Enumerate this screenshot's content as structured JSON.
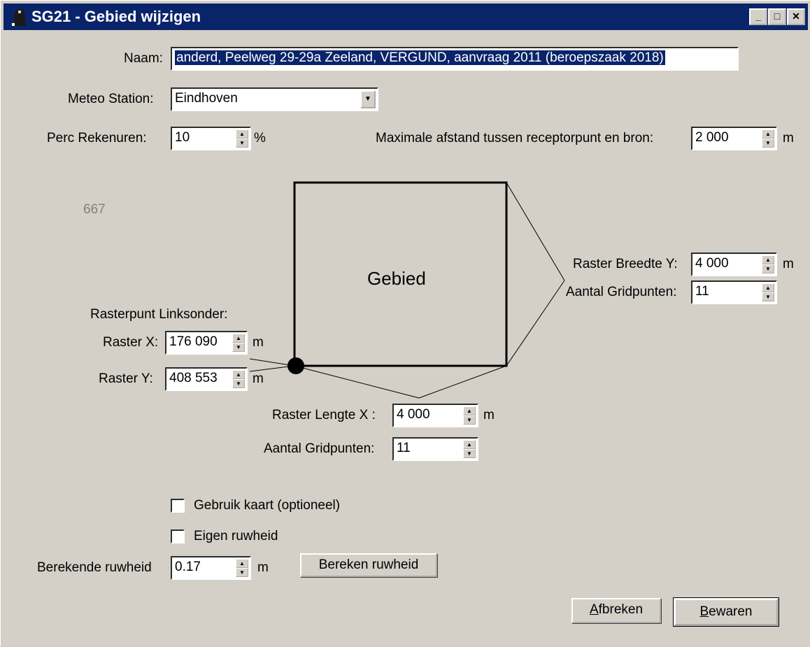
{
  "window": {
    "title": "SG21 - Gebied wijzigen",
    "minimize": "_",
    "maximize": "□",
    "close": "✕"
  },
  "naam": {
    "label": "Naam:",
    "value": "anderd, Peelweg 29-29a Zeeland, VERGUND, aanvraag 2011 (beroepszaak 2018)"
  },
  "meteo": {
    "label": "Meteo Station:",
    "value": "Eindhoven"
  },
  "perc": {
    "label": "Perc Rekenuren:",
    "value": "10",
    "unit": "%"
  },
  "max_afstand": {
    "label": "Maximale afstand tussen receptorpunt en bron:",
    "value": "2 000",
    "unit": "m"
  },
  "gray_number": "667",
  "diagram": {
    "area_label": "Gebied"
  },
  "raster_breedte": {
    "label": "Raster Breedte Y:",
    "value": "4 000",
    "unit": "m"
  },
  "gridpunten_y": {
    "label": "Aantal Gridpunten:",
    "value": "11"
  },
  "rasterpunt": {
    "heading": "Rasterpunt Linksonder:",
    "x_label": "Raster X:",
    "x_value": "176 090",
    "x_unit": "m",
    "y_label": "Raster Y:",
    "y_value": "408 553",
    "y_unit": "m"
  },
  "raster_lengte": {
    "label": "Raster Lengte X :",
    "value": "4 000",
    "unit": "m"
  },
  "gridpunten_x": {
    "label": "Aantal Gridpunten:",
    "value": "11"
  },
  "gebruik_kaart": {
    "label": "Gebruik kaart (optioneel)",
    "checked": false
  },
  "eigen_ruwheid": {
    "label": "Eigen ruwheid",
    "checked": false
  },
  "berekende": {
    "label": "Berekende ruwheid",
    "value": "0.17",
    "unit": "m"
  },
  "buttons": {
    "bereken": "Bereken ruwheid",
    "afbreken_first": "A",
    "afbreken_rest": "fbreken",
    "bewaren_first": "B",
    "bewaren_rest": "ewaren"
  }
}
